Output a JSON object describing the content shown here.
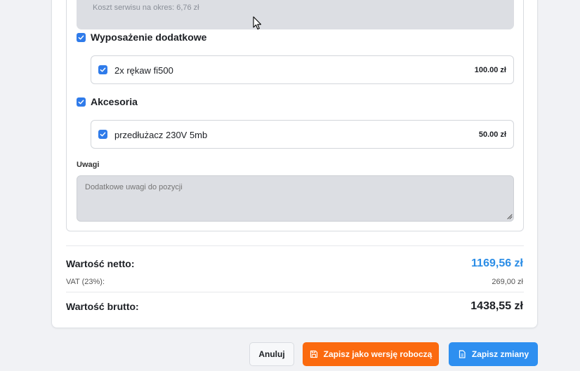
{
  "form": {
    "service_cost_text": "Koszt serwisu na okres: 6,76 zł",
    "groups": [
      {
        "title": "Wyposażenie dodatkowe",
        "checked": true,
        "items": [
          {
            "name": "2x rękaw fi500",
            "price": "100.00 zł",
            "checked": true
          }
        ]
      },
      {
        "title": "Akcesoria",
        "checked": true,
        "items": [
          {
            "name": "przedłużacz 230V 5mb",
            "price": "50.00 zł",
            "checked": true
          }
        ]
      }
    ],
    "notes_label": "Uwagi",
    "notes_placeholder": "Dodatkowe uwagi do pozycji",
    "notes_value": ""
  },
  "summary": {
    "net_label": "Wartość netto:",
    "net_value": "1169,56 zł",
    "vat_label": "VAT (23%):",
    "vat_value": "269,00 zł",
    "gross_label": "Wartość brutto:",
    "gross_value": "1438,55 zł"
  },
  "actions": {
    "cancel_label": "Anuluj",
    "draft_label": "Zapisz jako wersję roboczą",
    "save_label": "Zapisz zmiany"
  },
  "colors": {
    "accent_blue": "#2f7bea",
    "net_value": "#2b8de6",
    "draft_button": "#fb6a0f",
    "save_button": "#2e8ff0"
  },
  "icons": {
    "checkbox": "checkmark-icon",
    "draft_button": "floppy-disk-icon",
    "save_button": "document-icon",
    "notes_resize": "resize-grip-icon",
    "cursor": "mouse-cursor-icon"
  }
}
